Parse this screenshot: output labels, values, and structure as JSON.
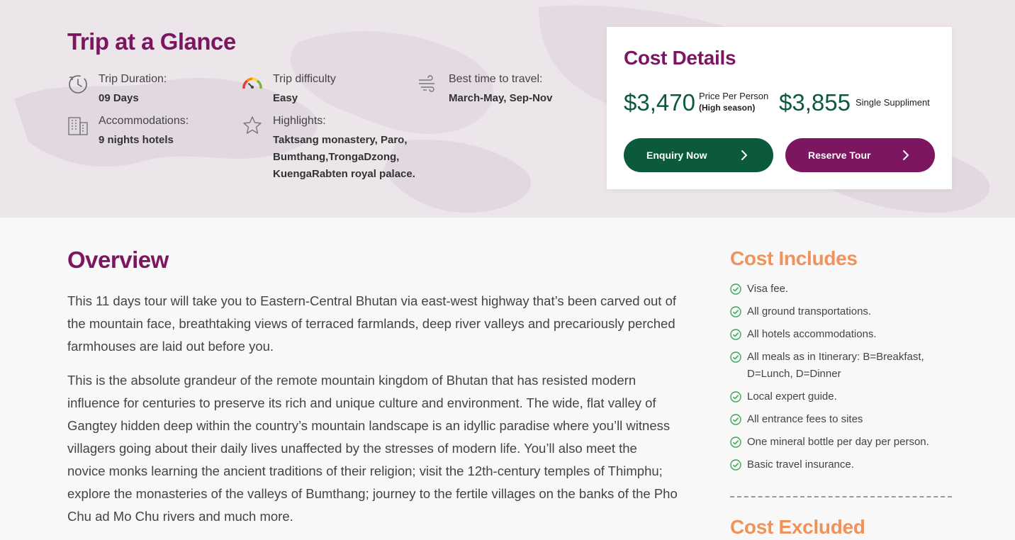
{
  "glance": {
    "title": "Trip at a Glance",
    "facts": [
      {
        "icon": "clock-icon",
        "label": "Trip Duration:",
        "value": "09 Days"
      },
      {
        "icon": "gauge-icon",
        "label": "Trip difficulty",
        "value": "Easy"
      },
      {
        "icon": "wind-icon",
        "label": "Best time to travel:",
        "value": "March-May, Sep-Nov"
      },
      {
        "icon": "building-icon",
        "label": "Accommodations:",
        "value": "9 nights hotels"
      },
      {
        "icon": "star-icon",
        "label": "Highlights:",
        "value_lines": [
          "Taktsang monastery, Paro,",
          "Bumthang,TrongaDzong,",
          "KuengaRabten royal palace."
        ]
      }
    ]
  },
  "cost_details": {
    "title": "Cost Details",
    "price_per_person": "$3,470",
    "price_per_person_label": "Price Per Person",
    "price_per_person_note": "(High season)",
    "single_supplement": "$3,855",
    "single_supplement_label": "Single Suppliment",
    "enquiry_label": "Enquiry Now",
    "reserve_label": "Reserve Tour"
  },
  "overview": {
    "title": "Overview",
    "paragraphs": [
      "This 11 days tour will take you to Eastern-Central Bhutan via east-west highway that’s been carved out of the mountain face, breathtaking views of terraced farmlands, deep river valleys and precariously perched farmhouses are laid out before you.",
      "This is the absolute grandeur of the remote mountain kingdom of Bhutan that has resisted modern influence for centuries to preserve its rich and unique culture and environment. The wide, flat valley of Gangtey hidden deep within the country’s mountain landscape is an idyllic paradise where you’ll witness villagers going about their daily lives unaffected by the stresses of modern life. You’ll also meet the novice monks learning the ancient traditions of their religion; visit the 12th-century temples of Thimphu; explore the monasteries of the valleys of Bumthang; journey to the fertile villages on the banks of the Pho Chu ad Mo Chu rivers and much more."
    ]
  },
  "cost_includes": {
    "title": "Cost Includes",
    "items": [
      "Visa fee.",
      "All ground transportations.",
      "All hotels accommodations.",
      "All meals as in Itinerary: B=Breakfast, D=Lunch, D=Dinner",
      "Local expert guide.",
      "All entrance fees to sites",
      "One mineral bottle per day per person.",
      "Basic travel insurance."
    ]
  },
  "cost_excluded": {
    "title": "Cost Excluded"
  },
  "colors": {
    "brand_purple": "#7c1660",
    "brand_green": "#0c5a3c",
    "accent_orange": "#f0935a",
    "check_green": "#3aa55a"
  }
}
